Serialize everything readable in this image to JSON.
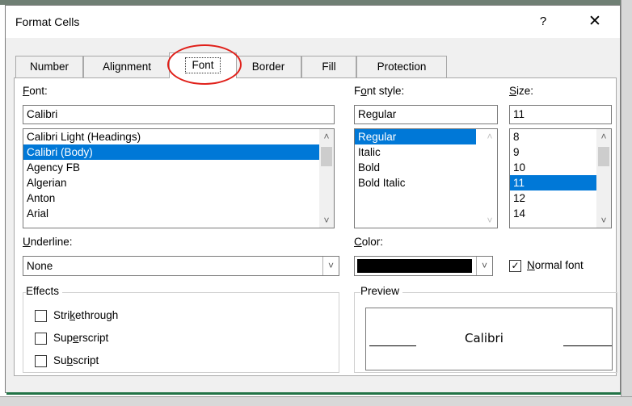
{
  "dialog": {
    "title": "Format Cells",
    "help": "?",
    "close": "✕"
  },
  "tabs": [
    {
      "label": "Number"
    },
    {
      "label": "Alignment"
    },
    {
      "label": "Font"
    },
    {
      "label": "Border"
    },
    {
      "label": "Fill"
    },
    {
      "label": "Protection"
    }
  ],
  "active_tab": "Font",
  "font": {
    "label_key": "F",
    "label_rest": "ont:",
    "value": "Calibri",
    "list": [
      "Calibri Light (Headings)",
      "Calibri (Body)",
      "Agency FB",
      "Algerian",
      "Anton",
      "Arial"
    ],
    "selected": "Calibri (Body)"
  },
  "font_style": {
    "label_pre": "F",
    "label_key": "o",
    "label_rest": "nt style:",
    "value": "Regular",
    "list": [
      "Regular",
      "Italic",
      "Bold",
      "Bold Italic"
    ],
    "selected": "Regular"
  },
  "size": {
    "label_key": "S",
    "label_rest": "ize:",
    "value": "11",
    "list": [
      "8",
      "9",
      "10",
      "11",
      "12",
      "14"
    ],
    "selected": "11"
  },
  "underline": {
    "label_key": "U",
    "label_rest": "nderline:",
    "value": "None"
  },
  "color": {
    "label_key": "C",
    "label_rest": "olor:",
    "value_hex": "#000000"
  },
  "normal_font": {
    "label_key": "N",
    "label_rest": "ormal font",
    "checked": true
  },
  "effects": {
    "title": "Effects",
    "strikethrough": {
      "pre": "Stri",
      "key": "k",
      "post": "ethrough",
      "checked": false
    },
    "superscript": {
      "pre": "Sup",
      "key": "e",
      "post": "rscript",
      "checked": false
    },
    "subscript": {
      "pre": "Su",
      "key": "b",
      "post": "script",
      "checked": false
    }
  },
  "preview": {
    "title": "Preview",
    "text": "Calibri"
  },
  "icons": {
    "scroll_up": "˄",
    "scroll_down": "˅",
    "dropdown": "˅",
    "check": "✓"
  },
  "colors": {
    "selection": "#0078d7",
    "annotation_circle": "#e0201a",
    "excel_green": "#217346"
  }
}
